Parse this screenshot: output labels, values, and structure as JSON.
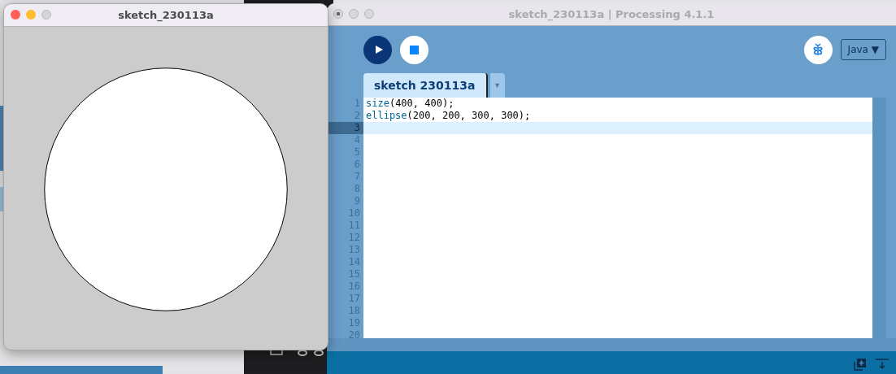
{
  "sketch_window": {
    "title": "sketch_230113a",
    "active": true,
    "canvas": {
      "kind": "ellipse"
    }
  },
  "editor_window": {
    "title": "sketch_230113a | Processing 4.1.1",
    "active": false,
    "toolbar": {
      "mode": "Java ▼"
    },
    "tabs": [
      {
        "label": "sketch 230113a",
        "selected": true
      }
    ],
    "tab_menu": "▼",
    "code_lines": [
      {
        "number": "1",
        "current": false,
        "tokens": [
          {
            "text": "size",
            "kind": "function"
          },
          {
            "text": "(400, 400);",
            "kind": "plain"
          }
        ]
      },
      {
        "number": "2",
        "current": false,
        "tokens": [
          {
            "text": "ellipse",
            "kind": "function"
          },
          {
            "text": "(200, 200, 300, 300);",
            "kind": "plain"
          }
        ]
      },
      {
        "number": "3",
        "current": true
      },
      {
        "number": "4",
        "current": false
      },
      {
        "number": "5",
        "current": false
      },
      {
        "number": "6",
        "current": false
      },
      {
        "number": "7",
        "current": false
      },
      {
        "number": "8",
        "current": false
      },
      {
        "number": "9",
        "current": false
      },
      {
        "number": "10",
        "current": false
      },
      {
        "number": "11",
        "current": false
      },
      {
        "number": "12",
        "current": false
      },
      {
        "number": "13",
        "current": false
      },
      {
        "number": "14",
        "current": false
      },
      {
        "number": "15",
        "current": false
      },
      {
        "number": "16",
        "current": false
      },
      {
        "number": "17",
        "current": false
      },
      {
        "number": "18",
        "current": false
      },
      {
        "number": "19",
        "current": false
      },
      {
        "number": "20",
        "current": false
      }
    ]
  }
}
